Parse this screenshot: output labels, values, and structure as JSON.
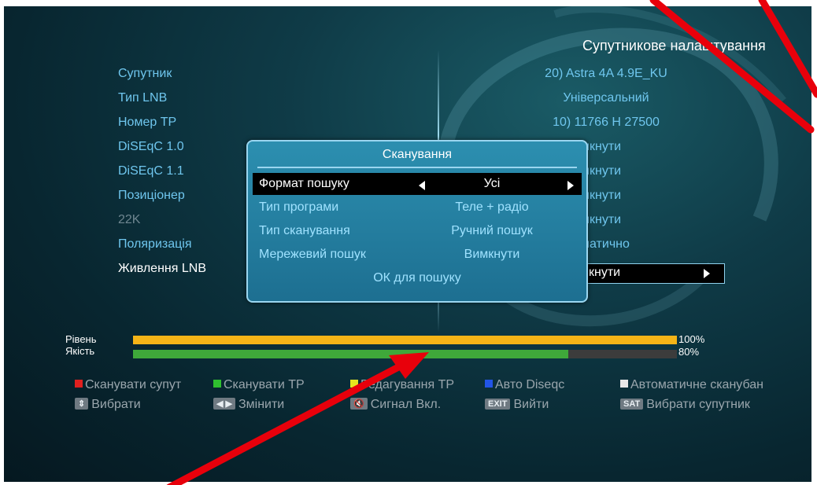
{
  "header": {
    "title": "Супутникове налаштування"
  },
  "settings": [
    {
      "label": "Супутник",
      "value": "20) Astra 4A 4.9E_KU"
    },
    {
      "label": "Тип LNB",
      "value": "Універсальний"
    },
    {
      "label": "Номер TP",
      "value": "10) 11766 H 27500"
    },
    {
      "label": "DiSEqC 1.0",
      "value": "мкнути"
    },
    {
      "label": "DiSEqC 1.1",
      "value": "мкнути"
    },
    {
      "label": "Позиціонер",
      "value": "мкнути"
    },
    {
      "label": "22K",
      "value": "мкнути"
    },
    {
      "label": "Поляризація",
      "value": "матично"
    },
    {
      "label": "Живлення LNB",
      "value": "мкнути"
    }
  ],
  "dialog": {
    "title": "Сканування",
    "rows": [
      {
        "label": "Формат пошуку",
        "value": "Усі"
      },
      {
        "label": "Тип програми",
        "value": "Теле + радіо"
      },
      {
        "label": "Тип сканування",
        "value": "Ручний пошук"
      },
      {
        "label": "Мережевий пошук",
        "value": "Вимкнути"
      }
    ],
    "ok_label": "ОК для пошуку"
  },
  "meters": {
    "level": {
      "label": "Рівень",
      "percent_text": "100%",
      "value": 1.0,
      "color": "#f5b417"
    },
    "quality": {
      "label": "Якість",
      "percent_text": "80%",
      "value": 0.8,
      "color": "#3fa83a"
    }
  },
  "legend": {
    "row1": [
      {
        "color": "#e0201f",
        "label": "Сканувати супут"
      },
      {
        "color": "#2fbf2f",
        "label": "Сканувати TP"
      },
      {
        "color": "#e6e61e",
        "label": "Редагування TP"
      },
      {
        "color": "#2255e6",
        "label": "Авто Diseqc"
      },
      {
        "color": "#e8e8e8",
        "label": "Автоматичне сканубан"
      }
    ],
    "row2": [
      {
        "key": "⇕",
        "label": "Вибрати"
      },
      {
        "key": "◀ ▶",
        "label": "Змінити"
      },
      {
        "key": "🔇",
        "label": "Сигнал Вкл."
      },
      {
        "key": "EXIT",
        "label": "Вийти"
      },
      {
        "key": "SAT",
        "label": "Вибрати супутник"
      }
    ]
  },
  "colors": {
    "annotation_arrow": "#e8000b",
    "accent": "#6fc6ee"
  }
}
